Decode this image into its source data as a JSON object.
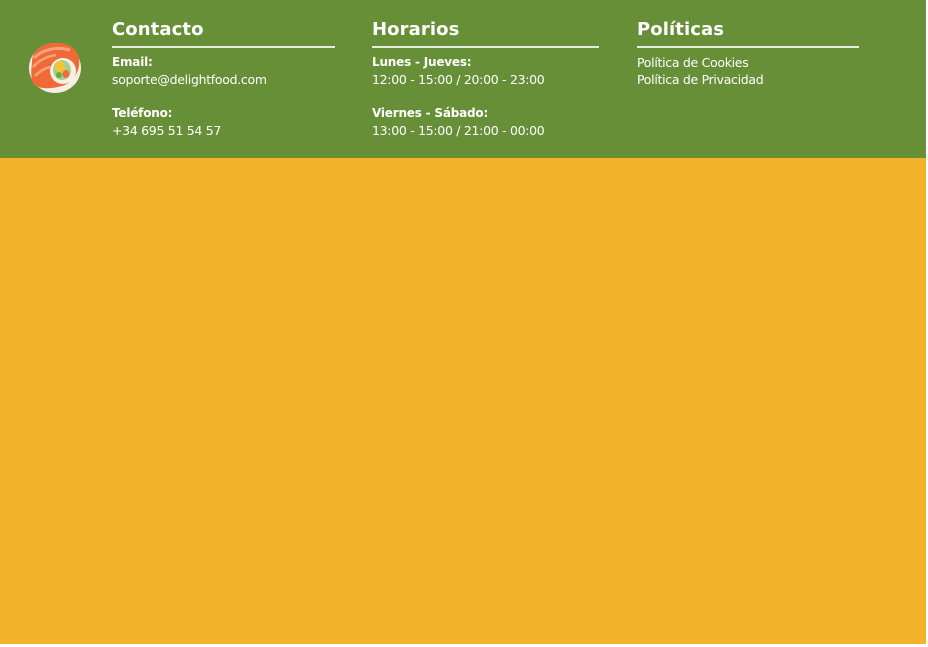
{
  "contacto": {
    "title": "Contacto",
    "email_label": "Email:",
    "email_value": "soporte@delightfood.com",
    "phone_label": "Teléfono:",
    "phone_value": "+34 695 51 54 57"
  },
  "horarios": {
    "title": "Horarios",
    "weekday_label": "Lunes - Jueves:",
    "weekday_hours": "12:00 - 15:00 / 20:00 - 23:00",
    "weekend_label": "Viernes - Sábado:",
    "weekend_hours": "13:00 - 15:00 / 21:00 - 00:00"
  },
  "politicas": {
    "title": "Políticas",
    "links": [
      "Política de Cookies",
      "Política de Privacidad"
    ]
  },
  "logo": {
    "icon": "sushi-roll-icon"
  },
  "colors": {
    "footer_background": "#678f37",
    "page_background": "#f2b32a",
    "text": "#ffffff"
  }
}
